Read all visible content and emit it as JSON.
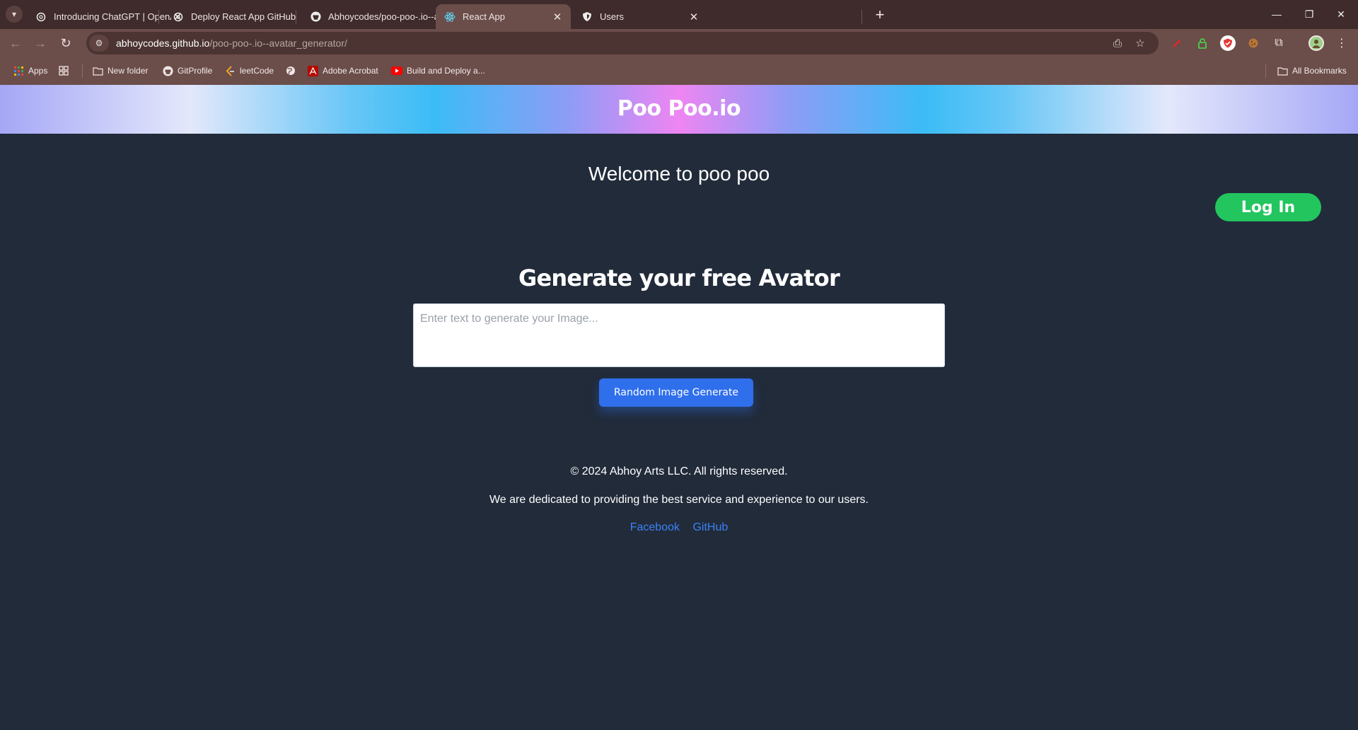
{
  "browser": {
    "tabs": [
      {
        "title": "Introducing ChatGPT | OpenAI",
        "icon": "openai-icon",
        "active": false
      },
      {
        "title": "Deploy React App GitHub",
        "icon": "openai-icon",
        "active": false
      },
      {
        "title": "Abhoycodes/poo-poo-.io--avat",
        "icon": "github-icon",
        "active": false
      },
      {
        "title": "React App",
        "icon": "react-icon",
        "active": true
      },
      {
        "title": "Users",
        "icon": "shield-icon",
        "active": false
      }
    ],
    "url_host": "abhoycodes.github.io",
    "url_path": "/poo-poo-.io--avatar_generator/",
    "bookmarks": {
      "apps": "Apps",
      "new_folder": "New folder",
      "gitprofile": "GitProfile",
      "leetcode": "leetCode",
      "adobe": "Adobe Acrobat",
      "build_deploy": "Build and Deploy a...",
      "all_bookmarks": "All Bookmarks"
    }
  },
  "page": {
    "logo": "Poo Poo.io",
    "welcome": "Welcome to poo poo",
    "login_label": "Log In",
    "generator_title": "Generate your free Avator",
    "prompt_placeholder": "Enter text to generate your Image...",
    "generate_button": "Random Image Generate",
    "footer": {
      "copyright": "© 2024 Abhoy Arts LLC. All rights reserved.",
      "tagline": "We are dedicated to providing the best service and experience to our users.",
      "links": [
        "Facebook",
        "GitHub"
      ]
    }
  },
  "colors": {
    "page_bg": "#212b3a",
    "login_green": "#22c55e",
    "primary_blue": "#2f6fec",
    "link_blue": "#3b82f6",
    "chrome_frame": "#3f2b2b",
    "chrome_toolbar": "#6b4d4a"
  }
}
